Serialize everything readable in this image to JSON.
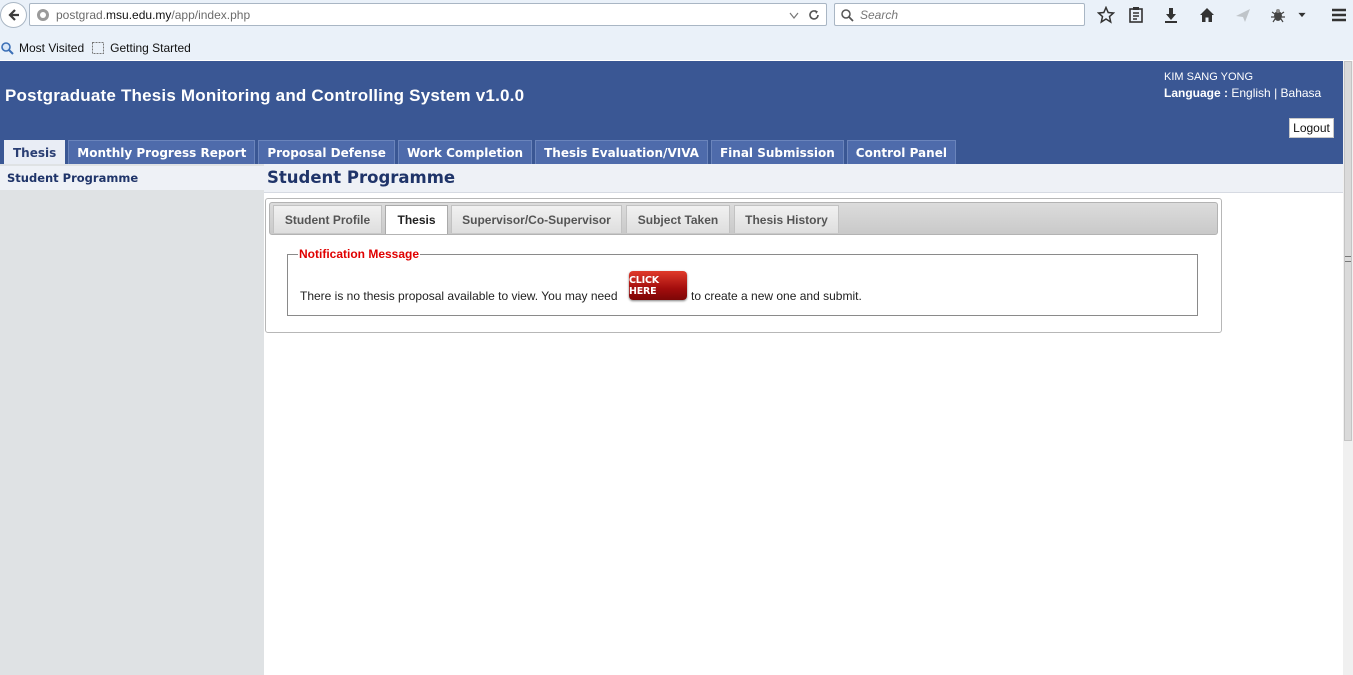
{
  "browser": {
    "url_prefix": "postgrad.",
    "url_domain": "msu.edu.my",
    "url_path": "/app/index.php",
    "search_placeholder": "Search",
    "bookmarks": [
      "Most Visited",
      "Getting Started"
    ]
  },
  "app": {
    "title": "Postgraduate Thesis Monitoring and Controlling System v1.0.0",
    "user_name": "KIM SANG YONG",
    "language_label": "Language :",
    "languages": [
      "English",
      "Bahasa"
    ],
    "language_separator": "|",
    "logout_label": "Logout"
  },
  "main_tabs": [
    "Thesis",
    "Monthly Progress Report",
    "Proposal Defense",
    "Work Completion",
    "Thesis Evaluation/VIVA",
    "Final Submission",
    "Control Panel"
  ],
  "active_main_tab": "Thesis",
  "sidebar": {
    "items": [
      "Student Programme"
    ]
  },
  "page": {
    "title": "Student Programme"
  },
  "sub_tabs": [
    "Student Profile",
    "Thesis",
    "Supervisor/Co-Supervisor",
    "Subject Taken",
    "Thesis History"
  ],
  "active_sub_tab": "Thesis",
  "notification": {
    "legend": "Notification Message",
    "text_before": "There is no thesis proposal available to view. You may need",
    "button_label": "CLICK HERE",
    "text_after": "to create a new one and submit."
  },
  "colors": {
    "header_bg": "#3a5794",
    "legend_red": "#e00000",
    "click_here_red": "#a30d0d"
  }
}
